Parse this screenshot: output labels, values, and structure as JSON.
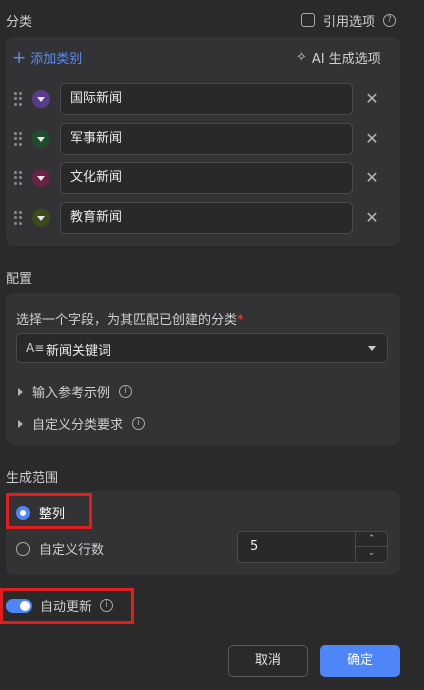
{
  "categories_section": {
    "title": "分类",
    "quote_option_label": "引用选项",
    "add_label": "添加类别",
    "ai_label": "AI 生成选项",
    "items": [
      {
        "label": "国际新闻",
        "color": "#5b3a8c"
      },
      {
        "label": "军事新闻",
        "color": "#1f4d2b"
      },
      {
        "label": "文化新闻",
        "color": "#6a2345"
      },
      {
        "label": "教育新闻",
        "color": "#3d4a1c"
      }
    ]
  },
  "config_section": {
    "title": "配置",
    "field_prompt": "选择一个字段，为其匹配已创建的分类",
    "required_mark": "*",
    "field_type_prefix": "A≡",
    "selected_field": "新闻关键词",
    "reference_examples_label": "输入参考示例",
    "custom_requirements_label": "自定义分类要求"
  },
  "range_section": {
    "title": "生成范围",
    "whole_column_label": "整列",
    "custom_rows_label": "自定义行数",
    "rows_value": "5"
  },
  "auto_update": {
    "label": "自动更新",
    "enabled": true
  },
  "footer": {
    "cancel_label": "取消",
    "confirm_label": "确定"
  },
  "colors": {
    "accent": "#4f86f7",
    "highlight_red": "#e11d1d"
  }
}
